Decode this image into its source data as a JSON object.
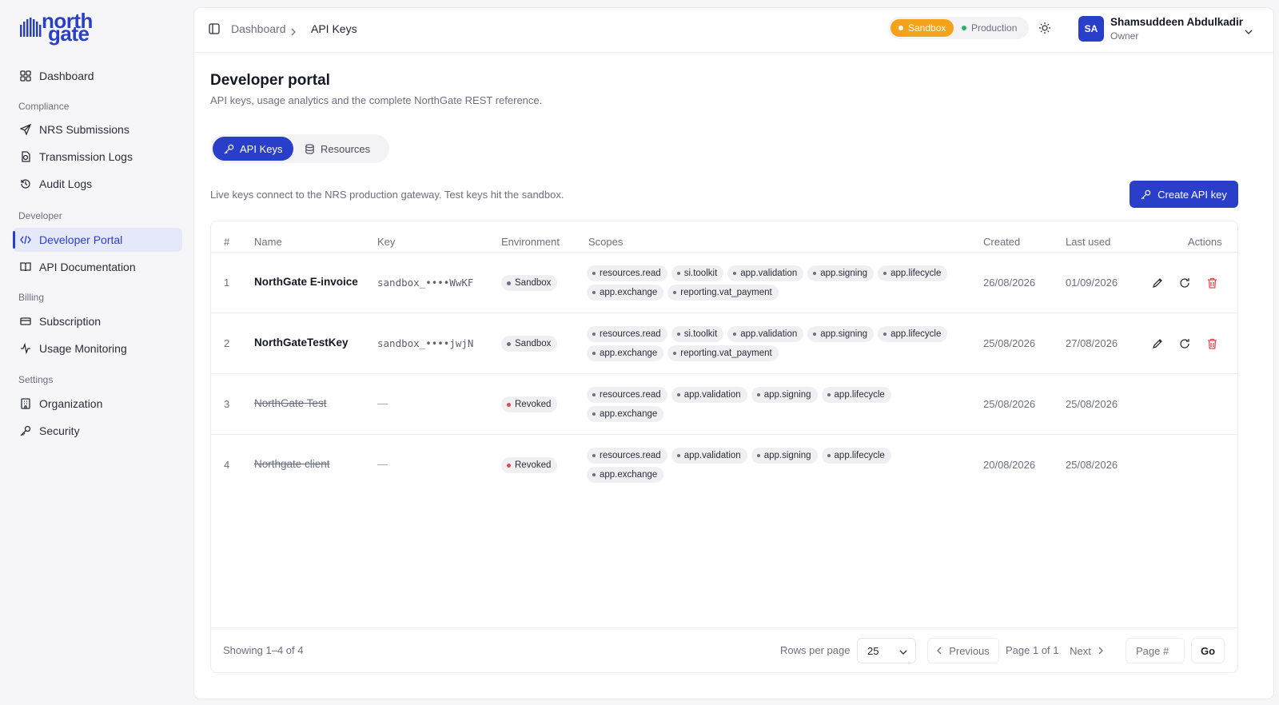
{
  "brand": {
    "logo_line1": "north",
    "logo_line2": "gate",
    "accent": "#2a3fc9"
  },
  "sidebar": {
    "items": [
      {
        "label": "Dashboard",
        "icon": "grid-icon"
      },
      {
        "label": "NRS Submissions",
        "icon": "send-icon"
      },
      {
        "label": "Transmission Logs",
        "icon": "file-clock-icon"
      },
      {
        "label": "Audit Logs",
        "icon": "history-icon"
      },
      {
        "label": "Developer Portal",
        "icon": "code-icon",
        "active": true
      },
      {
        "label": "API Documentation",
        "icon": "book-icon"
      },
      {
        "label": "Subscription",
        "icon": "card-icon"
      },
      {
        "label": "Usage Monitoring",
        "icon": "activity-icon"
      },
      {
        "label": "Organization",
        "icon": "building-icon"
      },
      {
        "label": "Security",
        "icon": "key-icon"
      }
    ],
    "sections": [
      "Compliance",
      "Developer",
      "Billing",
      "Settings"
    ]
  },
  "header": {
    "breadcrumb": [
      "Dashboard",
      "API Keys"
    ],
    "env_sandbox": "Sandbox",
    "env_production": "Production",
    "sandbox_color": "#f5a21b",
    "production_color": "#2cb36b",
    "user_initials": "SA",
    "user_name": "Shamsuddeen Abdulkadir",
    "user_role": "Owner"
  },
  "page": {
    "title": "Developer portal",
    "subtitle": "API keys, usage analytics and the complete NorthGate REST reference.",
    "tabs": [
      "API Keys",
      "Resources"
    ],
    "note": "Live keys connect to the NRS production gateway. Test keys hit the sandbox.",
    "create_button": "Create API key"
  },
  "table": {
    "columns": [
      "#",
      "Name",
      "Key",
      "Environment",
      "Scopes",
      "Created",
      "Last used",
      "Actions"
    ],
    "rows": [
      {
        "num": "1",
        "name": "NorthGate E-invoice",
        "key": "sandbox_••••WwKF",
        "env": "Sandbox",
        "revoked": false,
        "scopes": [
          "resources.read",
          "si.toolkit",
          "app.validation",
          "app.signing",
          "app.lifecycle",
          "app.exchange",
          "reporting.vat_payment"
        ],
        "created": "26/08/2026",
        "last_used": "01/09/2026"
      },
      {
        "num": "2",
        "name": "NorthGateTestKey",
        "key": "sandbox_••••jwjN",
        "env": "Sandbox",
        "revoked": false,
        "scopes": [
          "resources.read",
          "si.toolkit",
          "app.validation",
          "app.signing",
          "app.lifecycle",
          "app.exchange",
          "reporting.vat_payment"
        ],
        "created": "25/08/2026",
        "last_used": "27/08/2026"
      },
      {
        "num": "3",
        "name": "NorthGate Test",
        "key": "—",
        "env": "Revoked",
        "revoked": true,
        "scopes": [
          "resources.read",
          "app.validation",
          "app.signing",
          "app.lifecycle",
          "app.exchange"
        ],
        "created": "25/08/2026",
        "last_used": "25/08/2026"
      },
      {
        "num": "4",
        "name": "Northgate client",
        "key": "—",
        "env": "Revoked",
        "revoked": true,
        "scopes": [
          "resources.read",
          "app.validation",
          "app.signing",
          "app.lifecycle",
          "app.exchange"
        ],
        "created": "20/08/2026",
        "last_used": "25/08/2026"
      }
    ]
  },
  "pagination": {
    "showing": "Showing 1–4 of 4",
    "rows_per_page_label": "Rows per page",
    "rows_per_page": "25",
    "previous": "Previous",
    "page_info": "Page 1 of 1",
    "next": "Next",
    "page_placeholder": "Page #",
    "go": "Go"
  }
}
